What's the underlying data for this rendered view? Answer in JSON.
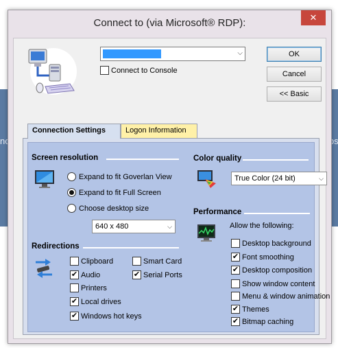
{
  "window": {
    "title": "Connect to (via Microsoft® RDP):",
    "close_glyph": "✕"
  },
  "host": {
    "icon": "computer-network-icon",
    "value": "redacted-hostname",
    "connect_to_console_label": "Connect to Console",
    "connect_to_console_checked": false
  },
  "buttons": {
    "ok": "OK",
    "cancel": "Cancel",
    "basic": "<< Basic"
  },
  "tabs": [
    {
      "label": "Connection Settings",
      "active": true
    },
    {
      "label": "Logon Information",
      "active": false
    }
  ],
  "screen_resolution": {
    "title": "Screen resolution",
    "icon": "monitor-icon",
    "options": [
      {
        "label": "Expand to fit Goverlan View",
        "selected": false
      },
      {
        "label": "Expand to fit Full Screen",
        "selected": true
      },
      {
        "label": "Choose desktop size",
        "selected": false
      }
    ],
    "size_value": "640 x 480"
  },
  "color_quality": {
    "title": "Color quality",
    "icon": "color-palette-icon",
    "value": "True Color (24 bit)"
  },
  "redirections": {
    "title": "Redirections",
    "icon": "redirect-arrows-icon",
    "items": [
      {
        "label": "Clipboard",
        "checked": false
      },
      {
        "label": "Audio",
        "checked": true
      },
      {
        "label": "Printers",
        "checked": false
      },
      {
        "label": "Local drives",
        "checked": true
      },
      {
        "label": "Windows hot keys",
        "checked": true
      },
      {
        "label": "Smart Card",
        "checked": false
      },
      {
        "label": "Serial Ports",
        "checked": true
      }
    ]
  },
  "performance": {
    "title": "Performance",
    "icon": "performance-monitor-icon",
    "allow_label": "Allow the following:",
    "items": [
      {
        "label": "Desktop background",
        "checked": false
      },
      {
        "label": "Font smoothing",
        "checked": true
      },
      {
        "label": "Desktop composition",
        "checked": true
      },
      {
        "label": "Show window content",
        "checked": false
      },
      {
        "label": "Menu & window animation",
        "checked": false
      },
      {
        "label": "Themes",
        "checked": true
      },
      {
        "label": "Bitmap caching",
        "checked": true
      }
    ]
  },
  "background": {
    "left_fragment": "nc",
    "right_fragment": "os"
  }
}
